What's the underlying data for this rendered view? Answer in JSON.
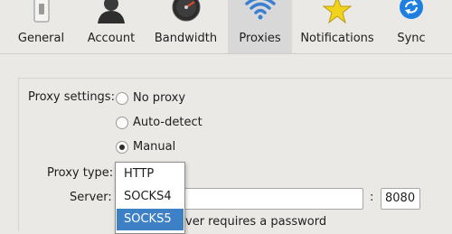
{
  "toolbar": {
    "tabs": [
      {
        "label": "General",
        "icon": "switch-icon"
      },
      {
        "label": "Account",
        "icon": "user-icon"
      },
      {
        "label": "Bandwidth",
        "icon": "speedometer-icon"
      },
      {
        "label": "Proxies",
        "icon": "wifi-icon",
        "selected": true
      },
      {
        "label": "Notifications",
        "icon": "star-icon"
      },
      {
        "label": "Sync",
        "icon": "sync-icon"
      }
    ]
  },
  "proxy": {
    "settings_label": "Proxy settings:",
    "options": [
      "No proxy",
      "Auto-detect",
      "Manual"
    ],
    "selected": "Manual",
    "type_label": "Proxy type:",
    "server_label": "Server:",
    "colon": ":",
    "port_value": "8080",
    "password_check_label": "ver requires a password"
  },
  "dropdown": {
    "options": [
      "HTTP",
      "SOCKS4",
      "SOCKS5"
    ],
    "highlighted": "SOCKS5"
  },
  "colors": {
    "selected_tab": "#d8d8d8",
    "highlight": "#3d80c6",
    "wifi_blue": "#3a7fd0",
    "star_yellow": "#f3d21c"
  }
}
